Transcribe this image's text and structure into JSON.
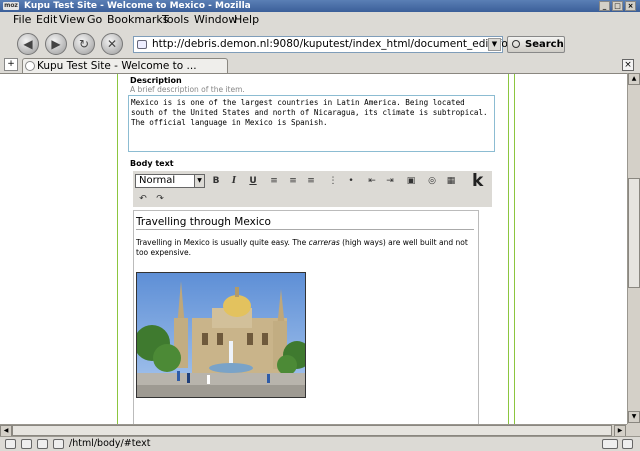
{
  "window": {
    "title": "Kupu Test Site - Welcome to Mexico - Mozilla",
    "app_badge": "moz",
    "minimize": "_",
    "maximize": "□",
    "close": "×"
  },
  "menu": {
    "items": [
      {
        "label": "File"
      },
      {
        "label": "Edit"
      },
      {
        "label": "View"
      },
      {
        "label": "Go"
      },
      {
        "label": "Bookmarks"
      },
      {
        "label": "Tools"
      },
      {
        "label": "Window"
      },
      {
        "label": "Help"
      }
    ]
  },
  "nav": {
    "back_icon": "◀",
    "forward_icon": "▶",
    "reload_icon": "↻",
    "stop_icon": "✕",
    "url": "http://debris.demon.nl:9080/kuputest/index_html/document_edit_form",
    "url_dropdown": "▼",
    "search_label": "Search",
    "logo": "m"
  },
  "tabs": {
    "new_tab": "+",
    "active_label": "Kupu Test Site - Welcome to ...",
    "close": "×"
  },
  "form": {
    "description_label": "Description",
    "description_help": "A brief description of the item.",
    "description_value": "Mexico is is one of the largest countries in Latin America. Being located south of the United States and north of Nicaragua, its climate is subtropical. The official language in Mexico is Spanish.",
    "body_label": "Body text"
  },
  "editor_toolbar": {
    "style_value": "Normal",
    "style_arrow": "▼",
    "bold": "B",
    "italic": "I",
    "underline": "U",
    "align_left": "≡",
    "align_center": "≡",
    "align_right": "≡",
    "ordered_list": "⋮",
    "unordered_list": "•",
    "outdent": "⇤",
    "indent": "⇥",
    "image": "▣",
    "link": "◎",
    "table": "▦",
    "undo": "↶",
    "redo": "↷",
    "kupu_logo": "k"
  },
  "editor_content": {
    "heading": "Travelling through Mexico",
    "paragraph_before": "Travelling in Mexico is usually quite easy. The ",
    "paragraph_em": "carreras",
    "paragraph_after": " (high ways) are well built and not too expensive."
  },
  "scroll": {
    "up": "▲",
    "down": "▼",
    "left": "◀",
    "right": "▶"
  },
  "status": {
    "text": "/html/body/#text"
  }
}
